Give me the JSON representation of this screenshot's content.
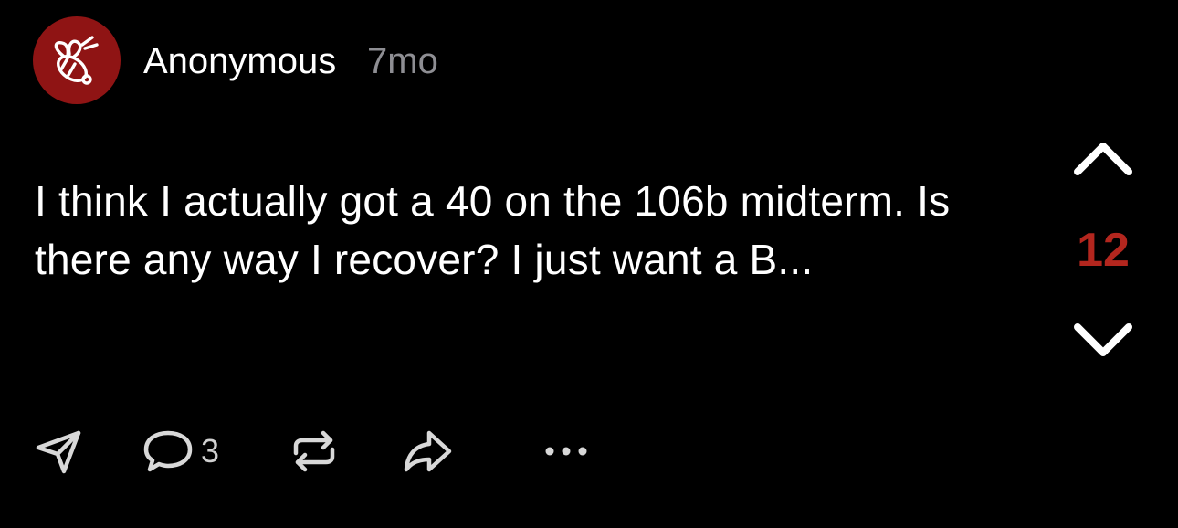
{
  "post": {
    "author": "Anonymous",
    "age": "7mo",
    "text": "I think I actually got a 40 on the 106b midterm. Is there any way I recover? I just want a B...",
    "avatar_icon": "bee-icon",
    "avatar_color": "#8f1414"
  },
  "vote": {
    "count": "12",
    "count_color": "#b3261e",
    "up_icon": "chevron-up-icon",
    "down_icon": "chevron-down-icon"
  },
  "actions": {
    "send_icon": "send-icon",
    "comment_icon": "comment-icon",
    "comment_count": "3",
    "repost_icon": "repost-icon",
    "share_icon": "share-icon",
    "more_icon": "more-icon"
  }
}
